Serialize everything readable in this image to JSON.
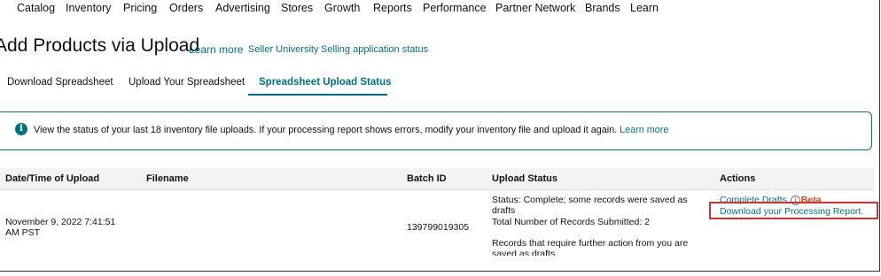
{
  "nav": {
    "items": [
      "Catalog",
      "Inventory",
      "Pricing",
      "Orders",
      "Advertising",
      "Stores",
      "Growth",
      "Reports",
      "Performance",
      "Partner Network",
      "Brands",
      "Learn"
    ]
  },
  "header": {
    "title": "Add Products via Upload",
    "links": [
      "Learn more",
      "Seller University",
      "Selling application status"
    ]
  },
  "tabs": [
    {
      "label": "Download Spreadsheet",
      "active": false
    },
    {
      "label": "Upload Your Spreadsheet",
      "active": false
    },
    {
      "label": "Spreadsheet Upload Status",
      "active": true
    }
  ],
  "info": {
    "icon": "info-icon",
    "text": "View the status of your last 18 inventory file uploads. If your processing report shows errors, modify your inventory file and upload it again.",
    "link": "Learn more"
  },
  "table": {
    "headers": [
      "Date/Time of Upload",
      "Filename",
      "Batch ID",
      "Upload Status",
      "Actions"
    ],
    "row": {
      "datetime": "November 9, 2022 7:41:51 AM PST",
      "filename": "",
      "batch_id": "139799019305",
      "status_line1": "Status: Complete; some records were saved as drafts",
      "status_line2": "Total Number of Records Submitted: 2",
      "status_line3": "Records that require further action from you are saved as drafts",
      "action_drafts": "Complete Drafts",
      "action_beta": "Beta",
      "action_report": "Download your Processing Report."
    }
  },
  "colors": {
    "accent": "#007185",
    "highlight": "#d23232",
    "beta": "#d14a11"
  }
}
